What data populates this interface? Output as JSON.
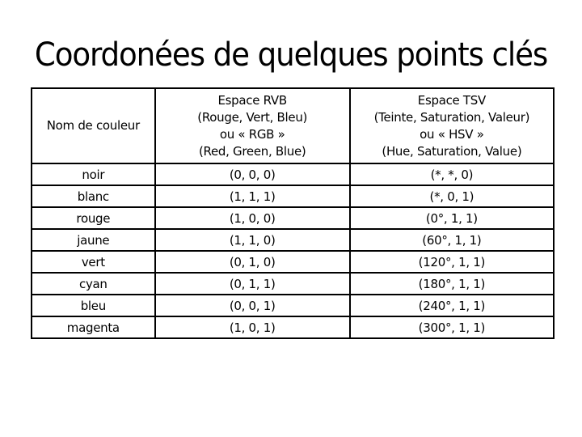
{
  "slide": {
    "title": "Coordonées de quelques points clés"
  },
  "table": {
    "headers": [
      {
        "lines": [
          "Nom de couleur"
        ]
      },
      {
        "lines": [
          "Espace RVB",
          "(Rouge, Vert, Bleu)",
          "ou « RGB »",
          "(Red, Green, Blue)"
        ]
      },
      {
        "lines": [
          "Espace TSV",
          "(Teinte, Saturation, Valeur)",
          "ou « HSV »",
          "(Hue, Saturation, Value)"
        ]
      }
    ],
    "rows": [
      {
        "name": "noir",
        "rgb": "(0, 0, 0)",
        "hsv": "(*, *, 0)"
      },
      {
        "name": "blanc",
        "rgb": "(1, 1, 1)",
        "hsv": "(*, 0, 1)"
      },
      {
        "name": "rouge",
        "rgb": "(1, 0, 0)",
        "hsv": "(0°, 1, 1)"
      },
      {
        "name": "jaune",
        "rgb": "(1, 1, 0)",
        "hsv": "(60°, 1, 1)"
      },
      {
        "name": "vert",
        "rgb": "(0, 1, 0)",
        "hsv": "(120°, 1, 1)"
      },
      {
        "name": "cyan",
        "rgb": "(0, 1, 1)",
        "hsv": "(180°, 1, 1)"
      },
      {
        "name": "bleu",
        "rgb": "(0, 0, 1)",
        "hsv": "(240°, 1, 1)"
      },
      {
        "name": "magenta",
        "rgb": "(1, 0, 1)",
        "hsv": "(300°, 1, 1)"
      }
    ]
  }
}
